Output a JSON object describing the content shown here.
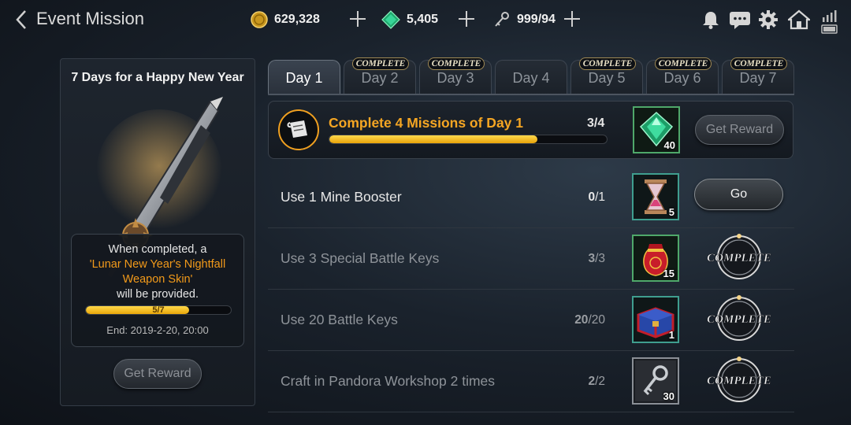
{
  "header": {
    "title": "Event Mission",
    "gold": "629,328",
    "gems": "5,405",
    "keys": "999/94"
  },
  "left_panel": {
    "title": "7 Days for a Happy New Year",
    "desc_before": "When completed, a",
    "desc_highlight": "'Lunar New Year's Nightfall Weapon Skin'",
    "desc_after": "will be provided.",
    "progress_text": "5/7",
    "progress": 0.71,
    "end_text": "End: 2019-2-20, 20:00",
    "reward_button": "Get Reward"
  },
  "tabs": [
    {
      "label": "Day 1",
      "badge": "",
      "active": true
    },
    {
      "label": "Day 2",
      "badge": "COMPLETE",
      "active": false
    },
    {
      "label": "Day 3",
      "badge": "COMPLETE",
      "active": false
    },
    {
      "label": "Day 4",
      "badge": "",
      "active": false
    },
    {
      "label": "Day 5",
      "badge": "COMPLETE",
      "active": false
    },
    {
      "label": "Day 6",
      "badge": "COMPLETE",
      "active": false
    },
    {
      "label": "Day 7",
      "badge": "COMPLETE",
      "active": false
    }
  ],
  "top_mission": {
    "label": "Complete 4 Missions of Day 1",
    "current": "3",
    "total": "/4",
    "progress": 0.75,
    "reward_icon": "green-gem-icon",
    "reward_qty": "40",
    "button": "Get Reward"
  },
  "missions": [
    {
      "label": "Use 1 Mine Booster",
      "current": "0",
      "total": "/1",
      "reward_icon": "hourglass-icon",
      "reward_qty": "5",
      "status": "go",
      "button": "Go"
    },
    {
      "label": "Use 3 Special Battle Keys",
      "current": "3",
      "total": "/3",
      "reward_icon": "red-pouch-icon",
      "reward_qty": "15",
      "status": "complete",
      "seal": "COMPLETE"
    },
    {
      "label": "Use 20 Battle Keys",
      "current": "20",
      "total": "/20",
      "reward_icon": "treasure-chest-icon",
      "reward_qty": "1",
      "status": "complete",
      "seal": "COMPLETE"
    },
    {
      "label": "Craft in Pandora Workshop 2 times",
      "current": "2",
      "total": "/2",
      "reward_icon": "key-icon",
      "reward_qty": "30",
      "status": "complete",
      "seal": "COMPLETE"
    }
  ],
  "colors": {
    "accent_orange": "#f5a623",
    "progress_yellow": "#f2c21a",
    "gem_green": "#2fd18a"
  }
}
